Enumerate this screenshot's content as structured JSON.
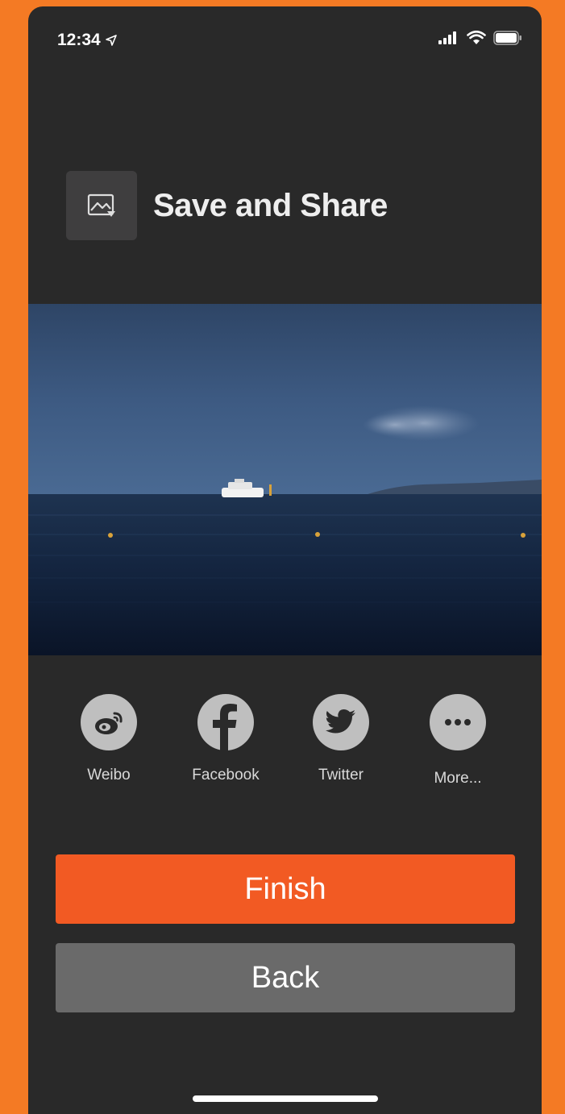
{
  "status_bar": {
    "time": "12:34",
    "icons": [
      "location-arrow-icon",
      "cellular-signal-icon",
      "wifi-icon",
      "battery-icon"
    ]
  },
  "header": {
    "icon": "image-save-icon",
    "title": "Save and Share"
  },
  "photo": {
    "subject": "boat-on-sea-photo"
  },
  "share": {
    "items": [
      {
        "label": "Weibo",
        "icon": "weibo-icon"
      },
      {
        "label": "Facebook",
        "icon": "facebook-icon"
      },
      {
        "label": "Twitter",
        "icon": "twitter-icon"
      },
      {
        "label": "More...",
        "icon": "more-dots-icon"
      }
    ]
  },
  "buttons": {
    "finish_label": "Finish",
    "back_label": "Back"
  },
  "colors": {
    "page_background": "#F47A24",
    "screen_background": "#292929",
    "finish_button": "#F25A23",
    "back_button": "#6A6A6A",
    "share_icon_circle": "#BFBFBF"
  }
}
